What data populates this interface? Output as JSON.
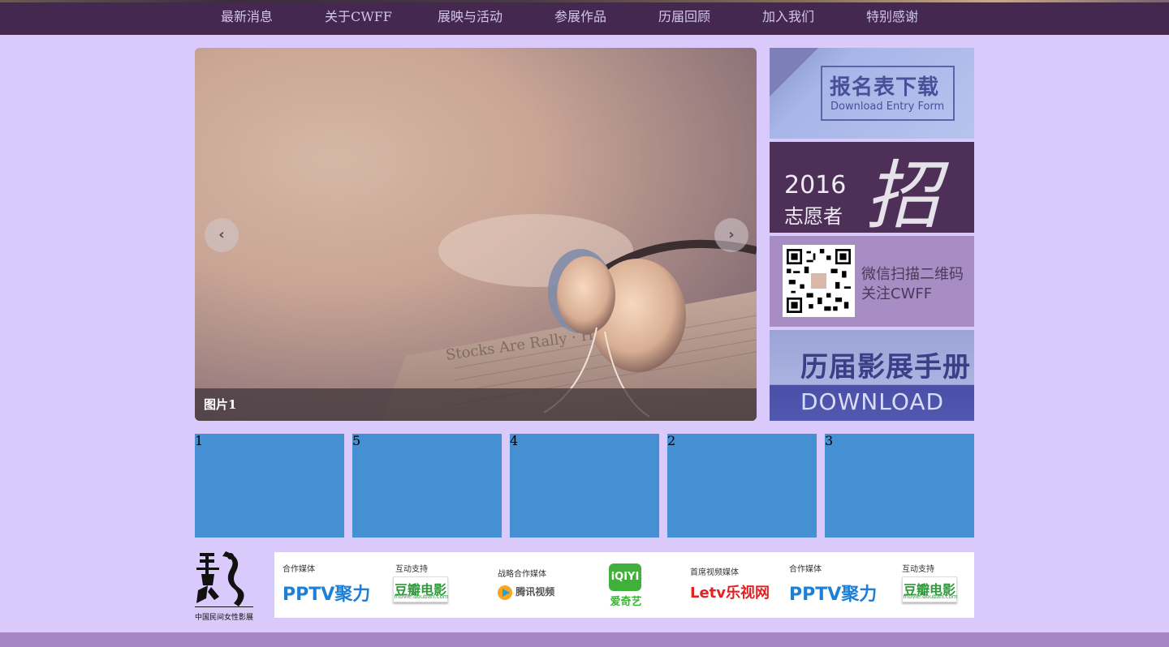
{
  "nav": {
    "items": [
      {
        "label": "最新消息"
      },
      {
        "label": "关于CWFF"
      },
      {
        "label": "展映与活动"
      },
      {
        "label": "参展作品"
      },
      {
        "label": "历届回顾"
      },
      {
        "label": "加入我们"
      },
      {
        "label": "特别感谢"
      }
    ]
  },
  "carousel": {
    "caption": "图片1",
    "prev_icon": "chevron-left-icon",
    "next_icon": "chevron-right-icon",
    "prev_glyph": "‹",
    "next_glyph": "›",
    "newspaper_text": "Stocks Are Rally · Hits a Snag"
  },
  "side_banners": {
    "entry_form": {
      "title": "报名表下载",
      "subtitle": "Download Entry Form"
    },
    "volunteer": {
      "year": "2016",
      "role": "志愿者",
      "headline": "招募"
    },
    "wechat": {
      "line1": "微信扫描二维码",
      "line2": "关注CWFF"
    },
    "brochure": {
      "title": "历届影展手册",
      "action": "DOWNLOAD"
    }
  },
  "thumbnails": [
    {
      "label": "1"
    },
    {
      "label": "5"
    },
    {
      "label": "4"
    },
    {
      "label": "2"
    },
    {
      "label": "3"
    }
  ],
  "logo": {
    "caption": "中国民间女性影展"
  },
  "partners": {
    "items": [
      {
        "label": "合作媒体",
        "name": "PPTV聚力"
      },
      {
        "label": "互动支持",
        "name": "豆瓣电影",
        "sub": "movie.douban.com"
      },
      {
        "label": "战略合作媒体",
        "name": "腾讯视频"
      },
      {
        "label": "",
        "name": "爱奇艺",
        "mark": "iQIYI"
      },
      {
        "label": "首席视频媒体",
        "name": "Letv乐视网"
      },
      {
        "label": "合作媒体",
        "name": "PPTV聚力"
      },
      {
        "label": "互动支持",
        "name": "豆瓣电影",
        "sub": "movie.douban.com"
      }
    ]
  },
  "colors": {
    "background": "#d9cafb",
    "navbar": "#45284f",
    "thumbnail": "#4590d3",
    "footer": "#a885c4"
  }
}
